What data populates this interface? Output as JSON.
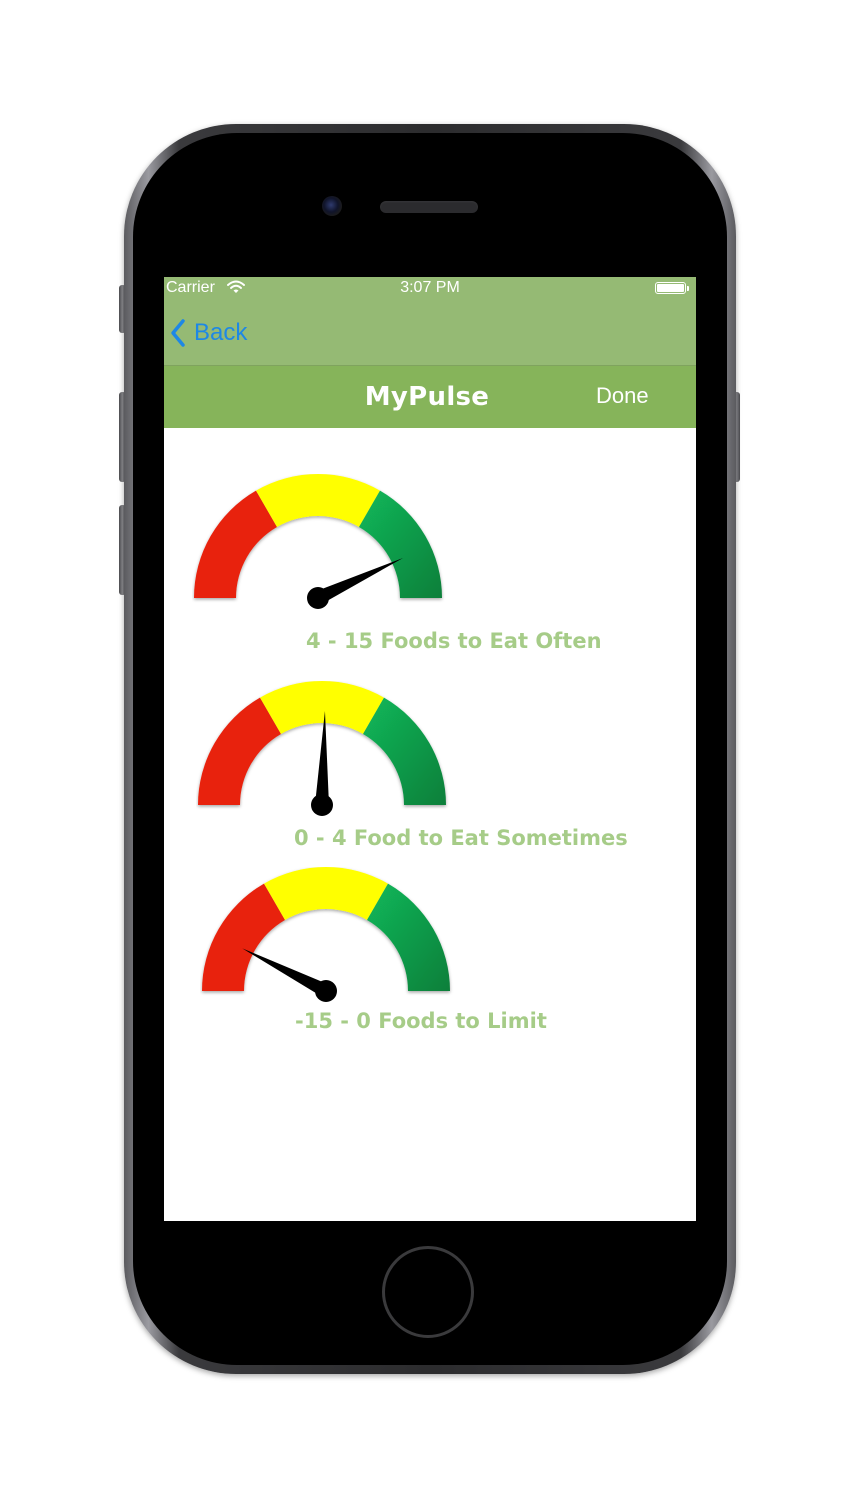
{
  "status_bar": {
    "carrier": "Carrier",
    "time": "3:07 PM",
    "wifi_icon": "wifi-icon",
    "battery_icon": "battery-icon"
  },
  "nav": {
    "back_label": "Back",
    "back_icon": "chevron-left-icon",
    "title": "MyPulse",
    "done_label": "Done"
  },
  "colors": {
    "status_bar_bg": "#95ba74",
    "nav_bar_bg": "#86b45a",
    "back_blue": "#1e88e5",
    "caption_green": "#a6cc88",
    "zone_red": "#e8200c",
    "zone_yellow": "#ffff00",
    "zone_green": "#1aa34a",
    "needle": "#000000"
  },
  "gauges": [
    {
      "caption": "4 - 15 Foods to Eat Often",
      "needle_fraction": 0.86
    },
    {
      "caption": "0 - 4 Food to Eat Sometimes",
      "needle_fraction": 0.51
    },
    {
      "caption": "-15 - 0 Foods to Limit",
      "needle_fraction": 0.15
    }
  ]
}
